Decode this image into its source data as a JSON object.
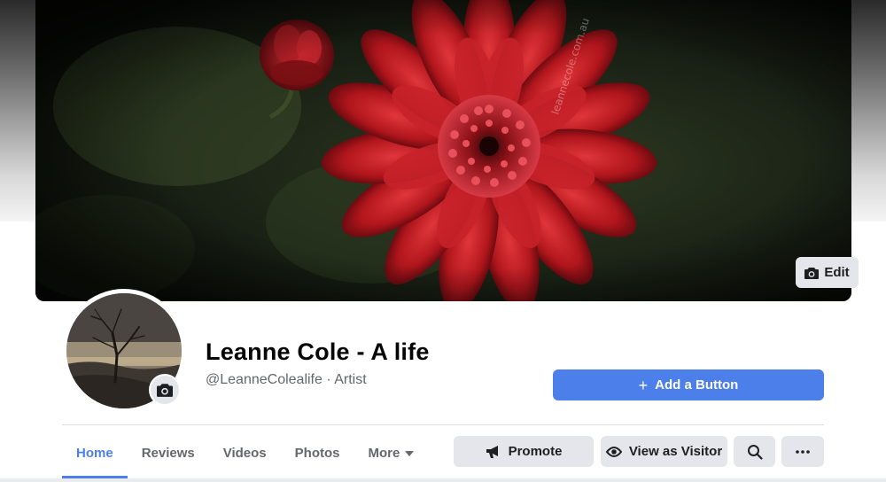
{
  "cover": {
    "watermark": "leannecole.com.au",
    "edit_label": "Edit"
  },
  "profile": {
    "name": "Leanne Cole - A life",
    "handle_category": "@LeanneColealife · Artist"
  },
  "cta": {
    "plus": "+",
    "label": "Add a Button",
    "color": "#4d7fea"
  },
  "tabs": [
    {
      "label": "Home",
      "active": true
    },
    {
      "label": "Reviews"
    },
    {
      "label": "Videos"
    },
    {
      "label": "Photos"
    },
    {
      "label": "More",
      "icon": "caret-down-icon"
    }
  ],
  "actions": {
    "promote_label": "Promote",
    "promote_icon": "megaphone-icon",
    "visitor_label": "View as Visitor",
    "visitor_icon": "eye-icon",
    "search_icon": "search-icon",
    "more_icon": "ellipsis-icon"
  }
}
